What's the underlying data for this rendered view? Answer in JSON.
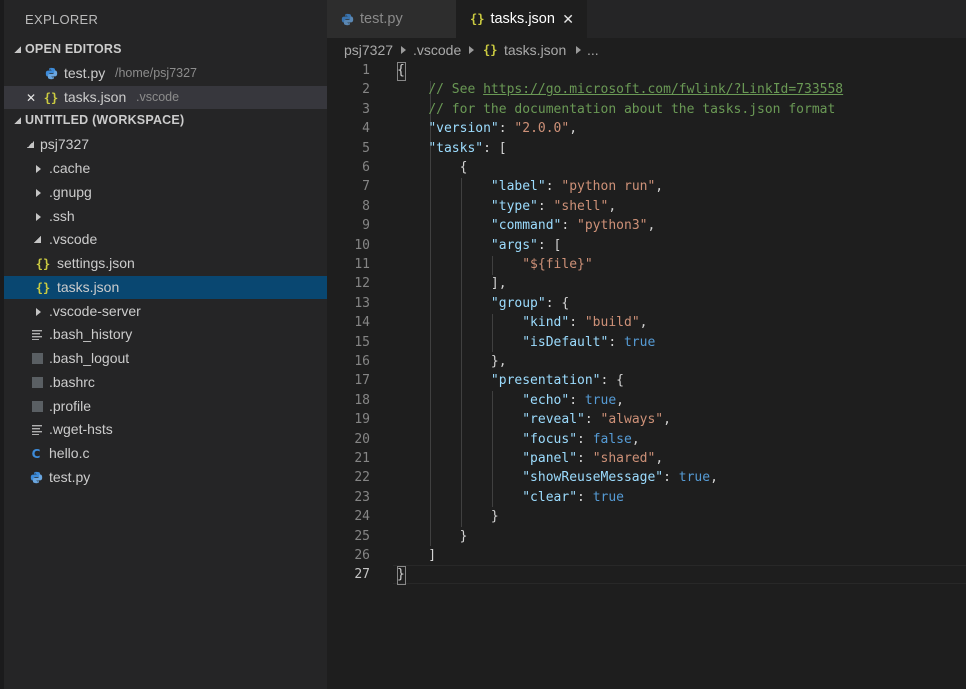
{
  "sidebar": {
    "title": "EXPLORER",
    "open_editors": {
      "header": "OPEN EDITORS",
      "items": [
        {
          "name": "test.py",
          "path": "/home/psj7327",
          "icon": "python-icon"
        },
        {
          "name": "tasks.json",
          "path": ".vscode",
          "icon": "json-icon"
        }
      ]
    },
    "workspace": {
      "header": "UNTITLED (WORKSPACE)",
      "root": "psj7327",
      "items": [
        {
          "name": ".cache",
          "type": "folder"
        },
        {
          "name": ".gnupg",
          "type": "folder"
        },
        {
          "name": ".ssh",
          "type": "folder"
        },
        {
          "name": ".vscode",
          "type": "folder-open"
        },
        {
          "name": "settings.json",
          "type": "json"
        },
        {
          "name": "tasks.json",
          "type": "json"
        },
        {
          "name": ".vscode-server",
          "type": "folder"
        },
        {
          "name": ".bash_history",
          "type": "text"
        },
        {
          "name": ".bash_logout",
          "type": "file"
        },
        {
          "name": ".bashrc",
          "type": "file"
        },
        {
          "name": ".profile",
          "type": "file"
        },
        {
          "name": ".wget-hsts",
          "type": "text"
        },
        {
          "name": "hello.c",
          "type": "c"
        },
        {
          "name": "test.py",
          "type": "python"
        }
      ]
    }
  },
  "tabs": [
    {
      "label": "test.py",
      "icon": "python-icon",
      "active": false
    },
    {
      "label": "tasks.json",
      "icon": "json-icon",
      "active": true
    }
  ],
  "breadcrumb": [
    "psj7327",
    ".vscode",
    "tasks.json",
    "..."
  ],
  "editor": {
    "active_line": 27,
    "line_numbers": [
      "1",
      "2",
      "3",
      "4",
      "5",
      "6",
      "7",
      "8",
      "9",
      "10",
      "11",
      "12",
      "13",
      "14",
      "15",
      "16",
      "17",
      "18",
      "19",
      "20",
      "21",
      "22",
      "23",
      "24",
      "25",
      "26",
      "27"
    ],
    "lines": [
      "{",
      "    // See https://go.microsoft.com/fwlink/?LinkId=733558",
      "    // for the documentation about the tasks.json format",
      "    \"version\": \"2.0.0\",",
      "    \"tasks\": [",
      "        {",
      "            \"label\": \"python run\",",
      "            \"type\": \"shell\",",
      "            \"command\": \"python3\",",
      "            \"args\": [",
      "                \"${file}\"",
      "            ],",
      "            \"group\": {",
      "                \"kind\": \"build\",",
      "                \"isDefault\": true",
      "            },",
      "            \"presentation\": {",
      "                \"echo\": true,",
      "                \"reveal\": \"always\",",
      "                \"focus\": false,",
      "                \"panel\": \"shared\",",
      "                \"showReuseMessage\": true,",
      "                \"clear\": true",
      "            }",
      "        }",
      "    ]",
      "}"
    ]
  },
  "colors": {
    "sidebar_bg": "#252526",
    "editor_bg": "#1e1e1e",
    "selection": "#094771",
    "json_icon": "#cbcb41",
    "python_icon": "#3d8bd9"
  }
}
